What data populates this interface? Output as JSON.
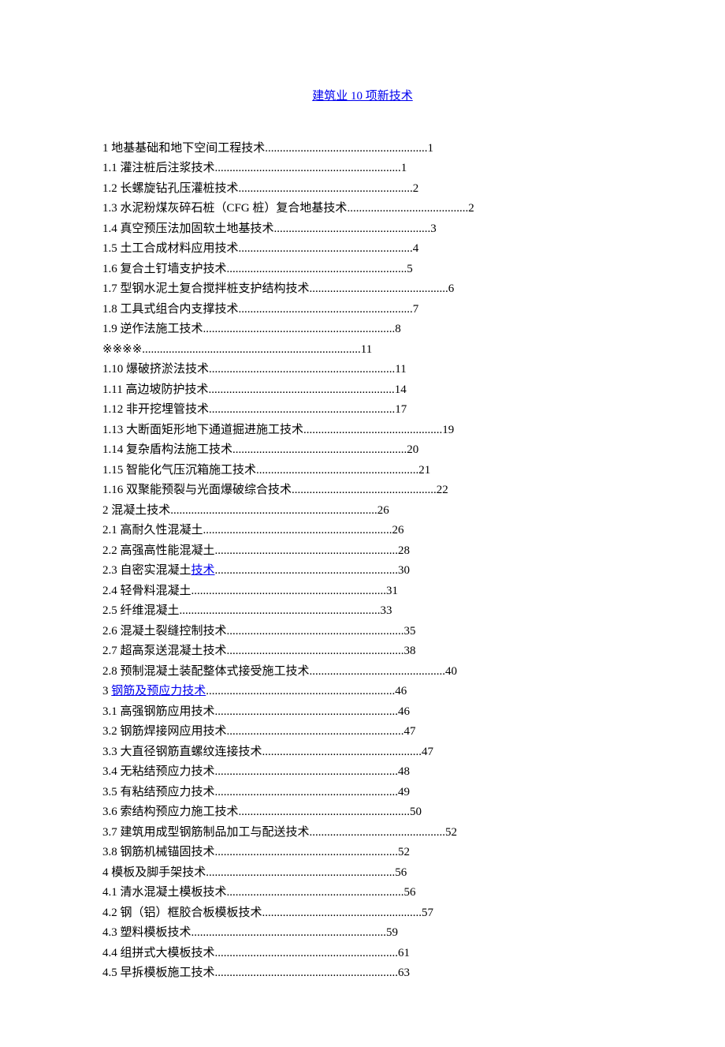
{
  "title": "建筑业 10 项新技术",
  "entries": [
    {
      "label": "1 地基基础和地下空间工程技术",
      "page": "1",
      "link": false
    },
    {
      "label": "1.1 灌注桩后注浆技术",
      "page": "1",
      "link": false
    },
    {
      "label": "1.2 长螺旋钻孔压灌桩技术",
      "page": "2",
      "link": false
    },
    {
      "label": "1.3 水泥粉煤灰碎石桩（CFG 桩）复合地基技术",
      "page": "2",
      "link": false
    },
    {
      "label": "1.4 真空预压法加固软土地基技术",
      "page": "3",
      "link": false
    },
    {
      "label": "1.5 土工合成材料应用技术",
      "page": "4",
      "link": false
    },
    {
      "label": "1.6 复合土钉墙支护技术",
      "page": "5",
      "link": false
    },
    {
      "label": "1.7 型钢水泥土复合搅拌桩支护结构技术",
      "page": "6",
      "link": false
    },
    {
      "label": "1.8 工具式组合内支撑技术",
      "page": "7",
      "link": false
    },
    {
      "label": "1.9 逆作法施工技术",
      "page": "8",
      "link": false
    },
    {
      "label": "※※※※",
      "page": "11",
      "link": false
    },
    {
      "label": "1.10 爆破挤淤法技术",
      "page": "11",
      "link": false
    },
    {
      "label": "1.11 高边坡防护技术",
      "page": "14",
      "link": false
    },
    {
      "label": "1.12 非开挖埋管技术",
      "page": "17",
      "link": false
    },
    {
      "label": "1.13 大断面矩形地下通道掘进施工技术",
      "page": "19",
      "link": false
    },
    {
      "label": "1.14 复杂盾构法施工技术",
      "page": "20",
      "link": false
    },
    {
      "label": "1.15 智能化气压沉箱施工技术",
      "page": "21",
      "link": false
    },
    {
      "label": "1.16 双聚能预裂与光面爆破综合技术",
      "page": "22",
      "link": false
    },
    {
      "label": "2 混凝土技术",
      "page": "26",
      "link": false
    },
    {
      "label": "2.1 高耐久性混凝土",
      "page": "26",
      "link": false
    },
    {
      "label": "2.2 高强高性能混凝土",
      "page": "28",
      "link": false
    },
    {
      "label": "2.3 自密实混凝土",
      "suffix": "技术",
      "page": "30",
      "linkSuffix": true
    },
    {
      "label": "2.4 轻骨料混凝土",
      "page": "31",
      "link": false
    },
    {
      "label": "2.5 纤维混凝土",
      "page": "33",
      "link": false
    },
    {
      "label": "2.6 混凝土裂缝控制技术",
      "page": "35",
      "link": false
    },
    {
      "label": "2.7 超高泵送混凝土技术",
      "page": "38",
      "link": false
    },
    {
      "label": "2.8 预制混凝土装配整体式接受施工技术",
      "page": "40",
      "link": false
    },
    {
      "label": "3 钢筋及预应力技术",
      "page": "46",
      "linkLabel": true,
      "prefixPlain": "3 "
    },
    {
      "label": "3.1 高强钢筋应用技术",
      "page": "46",
      "link": false
    },
    {
      "label": "3.2 钢筋焊接网应用技术",
      "page": "47",
      "link": false
    },
    {
      "label": "3.3 大直径钢筋直螺纹连接技术",
      "page": "47",
      "link": false
    },
    {
      "label": "3.4 无粘结预应力技术",
      "page": "48",
      "link": false
    },
    {
      "label": "3.5 有粘结预应力技术",
      "page": "49",
      "link": false
    },
    {
      "label": "3.6 索结构预应力施工技术",
      "page": "50",
      "link": false
    },
    {
      "label": "3.7 建筑用成型钢筋制品加工与配送技术",
      "page": "52",
      "link": false
    },
    {
      "label": "3.8 钢筋机械锚固技术",
      "page": "52",
      "link": false
    },
    {
      "label": "4 模板及脚手架技术",
      "page": "56",
      "link": false
    },
    {
      "label": "4.1 清水混凝土模板技术",
      "page": "56",
      "link": false
    },
    {
      "label": "4.2 钢（铝）框胶合板模板技术",
      "page": "57",
      "link": false
    },
    {
      "label": "4.3 塑料模板技术",
      "page": "59",
      "link": false
    },
    {
      "label": "4.4 组拼式大模板技术",
      "page": "61",
      "link": false
    },
    {
      "label": "4.5 早拆模板施工技术",
      "page": "63",
      "link": false
    }
  ],
  "lineWidth": 52
}
